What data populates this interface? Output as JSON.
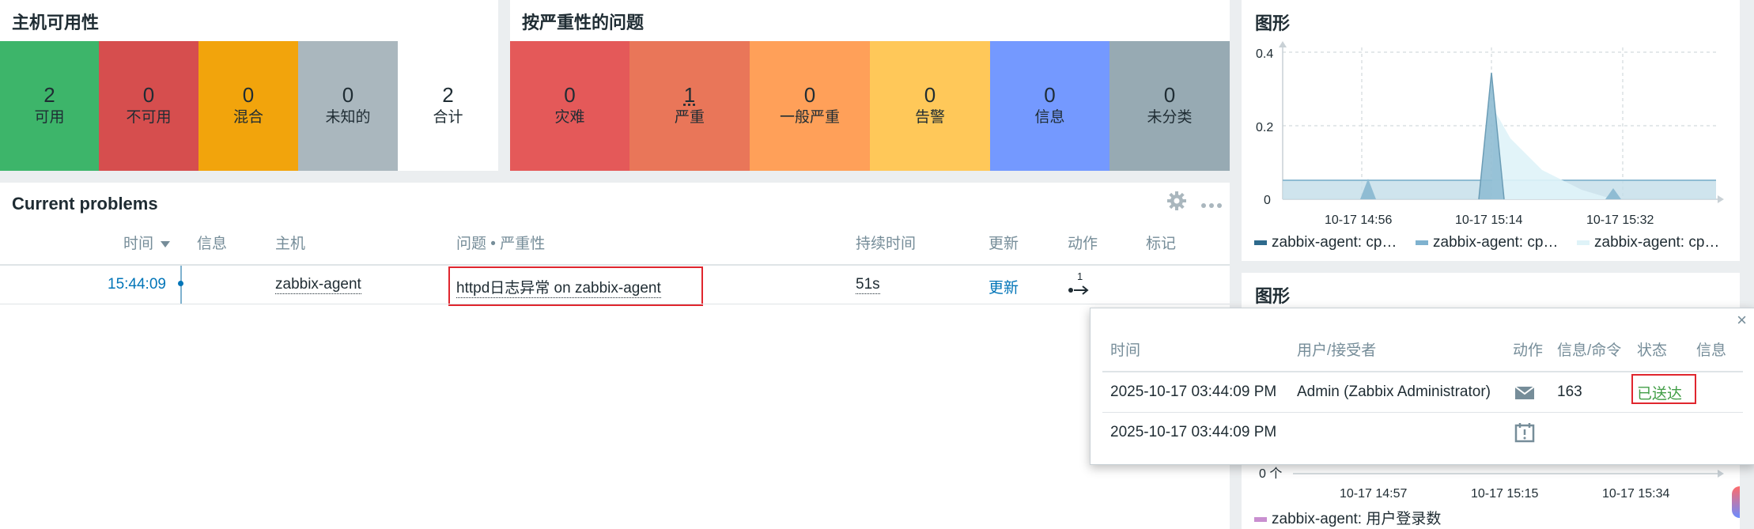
{
  "host_availability": {
    "title": "主机可用性",
    "tiles": [
      {
        "value": "2",
        "label": "可用",
        "color": "#3db56a"
      },
      {
        "value": "0",
        "label": "不可用",
        "color": "#d64e4e"
      },
      {
        "value": "0",
        "label": "混合",
        "color": "#f2a40c"
      },
      {
        "value": "0",
        "label": "未知的",
        "color": "#aab7be"
      },
      {
        "value": "2",
        "label": "合计",
        "color": "#ffffff"
      }
    ]
  },
  "severity": {
    "title": "按严重性的问题",
    "tiles": [
      {
        "value": "0",
        "label": "灾难",
        "color": "#e45959"
      },
      {
        "value": "1",
        "label": "严重",
        "color": "#e97659"
      },
      {
        "value": "0",
        "label": "一般严重",
        "color": "#ffa059"
      },
      {
        "value": "0",
        "label": "告警",
        "color": "#ffc859"
      },
      {
        "value": "0",
        "label": "信息",
        "color": "#7499ff"
      },
      {
        "value": "0",
        "label": "未分类",
        "color": "#97aab3"
      }
    ]
  },
  "problems": {
    "title": "Current problems",
    "columns": {
      "time": "时间",
      "info": "信息",
      "host": "主机",
      "problem": "问题 • 严重性",
      "duration": "持续时间",
      "update": "更新",
      "actions": "动作",
      "tags": "标记"
    },
    "row": {
      "time": "15:44:09",
      "host": "zabbix-agent",
      "problem": "httpd日志异常 on zabbix-agent",
      "duration": "51s",
      "update": "更新",
      "actions_count": "1"
    }
  },
  "graph1": {
    "title": "图形",
    "y_ticks": [
      "0.4",
      "0.2",
      "0"
    ],
    "x_ticks": [
      "10-17 14:56",
      "10-17 15:14",
      "10-17 15:32"
    ],
    "legend": [
      {
        "label": "zabbix-agent: cp…",
        "color": "#2e6a8c"
      },
      {
        "label": "zabbix-agent: cp…",
        "color": "#7fb2cf"
      },
      {
        "label": "zabbix-agent: cp…",
        "color": "#dff3f8"
      }
    ]
  },
  "graph2": {
    "title": "图形",
    "y_tick": "0 个",
    "x_ticks": [
      "10-17 14:57",
      "10-17 15:15",
      "10-17 15:34"
    ],
    "legend": [
      {
        "label": "zabbix-agent: 用户登录数",
        "color": "#c98fd0"
      }
    ]
  },
  "popup": {
    "close": "×",
    "columns": {
      "time": "时间",
      "user": "用户/接受者",
      "action": "动作",
      "message": "信息/命令",
      "status": "状态",
      "info": "信息"
    },
    "rows": [
      {
        "time": "2025-10-17 03:44:09 PM",
        "user": "Admin (Zabbix Administrator)",
        "message": "163",
        "status": "已送达",
        "icon": "envelope-icon"
      },
      {
        "time": "2025-10-17 03:44:09 PM",
        "user": "",
        "message": "",
        "status": "",
        "icon": "calendar-alert-icon"
      }
    ]
  },
  "colors": {
    "link": "#0275b8",
    "status_ok": "#429e47",
    "highlight": "#e0262e"
  }
}
